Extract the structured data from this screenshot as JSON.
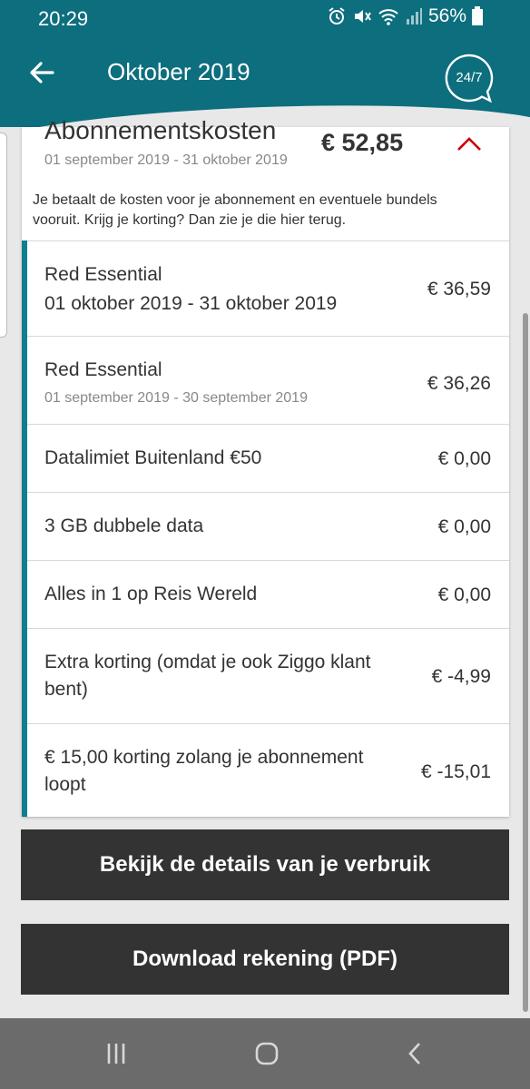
{
  "status_bar": {
    "time": "20:29",
    "battery": "56%",
    "icons": [
      "alarm-icon",
      "mute-icon",
      "wifi-icon",
      "signal-icon",
      "battery-icon"
    ]
  },
  "header": {
    "title": "Oktober 2019",
    "support_label": "24/7",
    "bg_color": "#0d6e7e"
  },
  "subscription": {
    "title": "Abonnementskosten",
    "period": "01 september 2019 - 31 oktober 2019",
    "total": "€ 52,85",
    "description": "Je betaalt de kosten voor je abonnement en eventuele bundels vooruit. Krijg je korting? Dan zie je die hier terug."
  },
  "items": [
    {
      "label": "Red Essential",
      "date_large": "01 oktober 2019 - 31 oktober 2019",
      "amount": "€ 36,59"
    },
    {
      "label": "Red Essential",
      "date_small": "01 september 2019 - 30 september 2019",
      "amount": "€ 36,26"
    },
    {
      "label": "Datalimiet Buitenland €50",
      "amount": "€ 0,00"
    },
    {
      "label": "3 GB dubbele data",
      "amount": "€ 0,00"
    },
    {
      "label": "Alles in 1 op Reis Wereld",
      "amount": "€ 0,00"
    },
    {
      "label": "Extra korting (omdat je ook Ziggo klant bent)",
      "amount": "€ -4,99"
    },
    {
      "label": "€ 15,00 korting zolang je abonnement loopt",
      "amount": "€ -15,01"
    }
  ],
  "buttons": {
    "usage": "Bekijk de details van je verbruik",
    "pdf": "Download rekening (PDF)"
  },
  "accent_color": "#cc0000"
}
